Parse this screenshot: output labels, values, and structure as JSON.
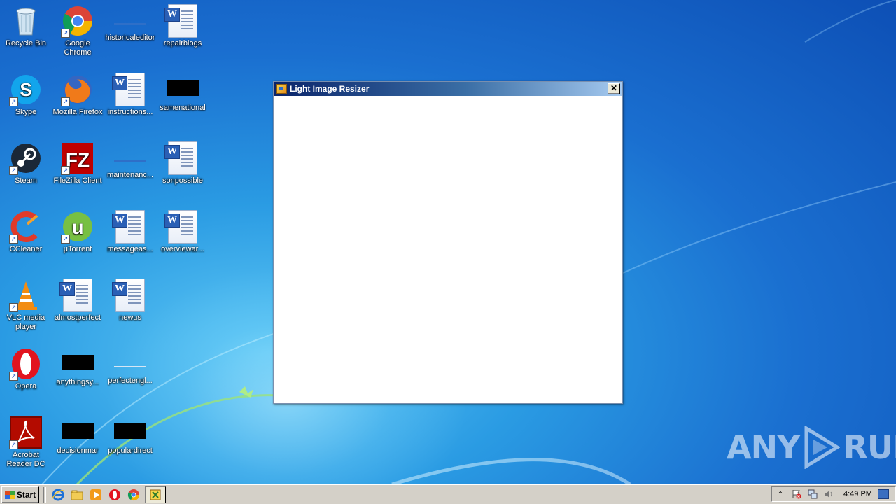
{
  "desktop": {
    "icons": [
      {
        "label": "Recycle Bin"
      },
      {
        "label": "Google Chrome"
      },
      {
        "label": "historicaleditor"
      },
      {
        "label": "repairblogs"
      },
      {
        "label": "Skype"
      },
      {
        "label": "Mozilla Firefox"
      },
      {
        "label": "instructions..."
      },
      {
        "label": "samenational"
      },
      {
        "label": "Steam"
      },
      {
        "label": "FileZilla Client"
      },
      {
        "label": "maintenanc..."
      },
      {
        "label": "sonpossible"
      },
      {
        "label": "CCleaner"
      },
      {
        "label": "µTorrent"
      },
      {
        "label": "messageas..."
      },
      {
        "label": "overviewar..."
      },
      {
        "label": "VLC media player"
      },
      {
        "label": "almostperfect"
      },
      {
        "label": "newus"
      },
      {
        "label": "Opera"
      },
      {
        "label": "anythingsy..."
      },
      {
        "label": "perfectengl..."
      },
      {
        "label": "Acrobat Reader DC"
      },
      {
        "label": "decisionmar"
      },
      {
        "label": "populardirect"
      }
    ]
  },
  "window": {
    "title": "Light Image Resizer",
    "close_glyph": "✕"
  },
  "watermark": {
    "left": "ANY",
    "right": "RUN"
  },
  "taskbar": {
    "start_label": "Start",
    "clock": "4:49 PM",
    "tray_expand": "⌃"
  },
  "colors": {
    "desktop_bg": "#1a6fd0",
    "titlebar_start": "#0a246a",
    "titlebar_end": "#a6caf0",
    "taskbar_bg": "#d4d0c8"
  }
}
